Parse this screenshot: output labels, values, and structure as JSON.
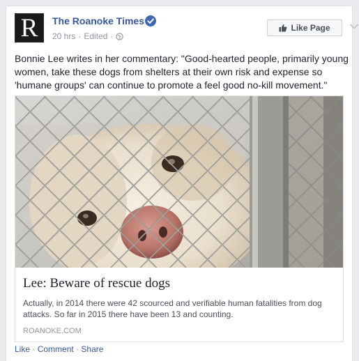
{
  "post": {
    "page": {
      "name": "The Roanoke Times",
      "avatar_letter": "R",
      "verified_icon": "verified-check-icon"
    },
    "meta": {
      "time": "20 hrs",
      "separator": "·",
      "edited": "Edited",
      "audience_icon": "globe-icon"
    },
    "like_page_button": {
      "label": "Like Page",
      "icon": "thumbs-up-icon"
    },
    "menu_icon": "chevron-down-icon",
    "text": "Bonnie Lee writes in her commentary: \"Good-hearted people, primarily young women, take these dogs from shelters at their own risk and expense so 'humane groups' can continue to promote a feel good no-kill movement.\"",
    "link_preview": {
      "image_subject": "dog behind chain-link fence",
      "title": "Lee: Beware of rescue dogs",
      "description": "Actually, in 2014 there were 42 scourced and verifiable human fatalities from dog attacks. So far in 2015 there have been 13 and counting.",
      "domain": "ROANOKE.COM"
    },
    "actions": {
      "like": "Like",
      "comment": "Comment",
      "share": "Share",
      "separator": "·"
    }
  },
  "colors": {
    "link": "#365899",
    "meta": "#90949c",
    "text": "#1d2129",
    "verified": "#4267b2",
    "background": "#e9ebee"
  }
}
